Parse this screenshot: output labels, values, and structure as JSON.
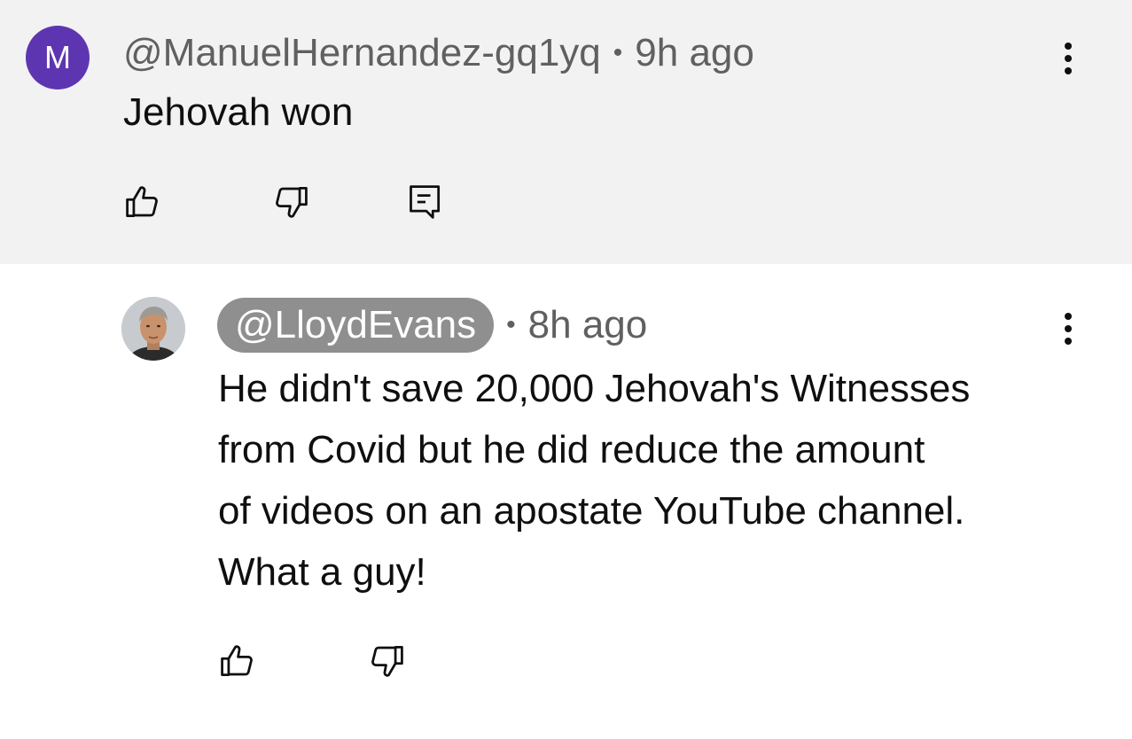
{
  "parent_comment": {
    "avatar_letter": "M",
    "avatar_color": "#5e35b1",
    "author": "@ManuelHernandez-gq1yq",
    "separator": "•",
    "time": "9h ago",
    "text": "Jehovah won",
    "actions": {
      "like_icon": "thumbs-up-icon",
      "dislike_icon": "thumbs-down-icon",
      "reply_icon": "reply-comment-icon"
    },
    "more_icon": "vertical-ellipsis-icon",
    "background_color": "#f2f2f2"
  },
  "reply": {
    "avatar_icon": "user-photo-avatar",
    "author": "@LloydEvans",
    "author_badge_color": "#8f8f8f",
    "separator": "•",
    "time": "8h ago",
    "text_lines": [
      "He didn't save 20,000 Jehovah's Witnesses",
      "from Covid but he did reduce the amount",
      "of videos on an apostate YouTube channel.",
      "What a guy!"
    ],
    "actions": {
      "like_icon": "thumbs-up-icon",
      "dislike_icon": "thumbs-down-icon"
    },
    "more_icon": "vertical-ellipsis-icon"
  }
}
